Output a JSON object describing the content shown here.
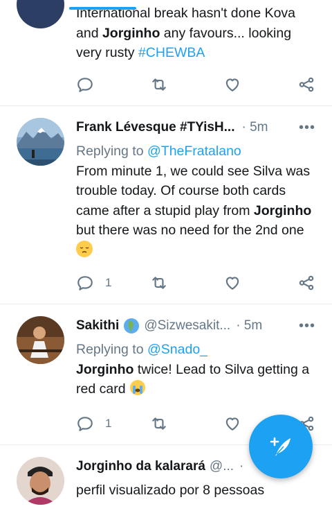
{
  "tweets": [
    {
      "text_line1": "International break hasn't done Kova",
      "text_bold": "Jorginho",
      "text_pre": "and ",
      "text_post": " any favours... looking",
      "text_line3": "very rusty ",
      "hashtag": "#CHEWBA",
      "reply_count": "",
      "avatar_icon": "user-avatar"
    },
    {
      "name": "Frank Lévesque #TYisH...",
      "handle": "",
      "time": "· 5m",
      "more": "•••",
      "replying_label": "Replying to ",
      "replying_to": "@TheFratalano",
      "text_a": "From minute 1, we could see Silva was trouble today. Of course both cards came after a stupid play from ",
      "text_bold": "Jorginho",
      "text_b": " but there was no need for the 2nd one ",
      "emoji": "pensive-face",
      "reply_count": "1",
      "avatar_icon": "mountain-lake-avatar"
    },
    {
      "name": "Sakithi",
      "name_emoji": "earth-africa-emoji",
      "handle": "@Sizwesakit...",
      "time": "· 5m",
      "more": "•••",
      "replying_label": "Replying to ",
      "replying_to": "@Snado_",
      "text_bold": "Jorginho",
      "text_a": " twice! Lead to Silva getting a red card ",
      "emoji": "crying-face",
      "reply_count": "1",
      "avatar_icon": "person-avatar"
    },
    {
      "name": "Jorginho da kalarará",
      "handle": "@...",
      "time": "· ",
      "text_a": "perfil visualizado por 8 pessoas",
      "avatar_icon": "person-avatar"
    }
  ],
  "fab": {
    "icon": "compose-tweet-icon"
  },
  "colors": {
    "accent": "#1da1f2",
    "muted": "#657786",
    "text": "#14171a",
    "divider": "#e6ecf0"
  }
}
